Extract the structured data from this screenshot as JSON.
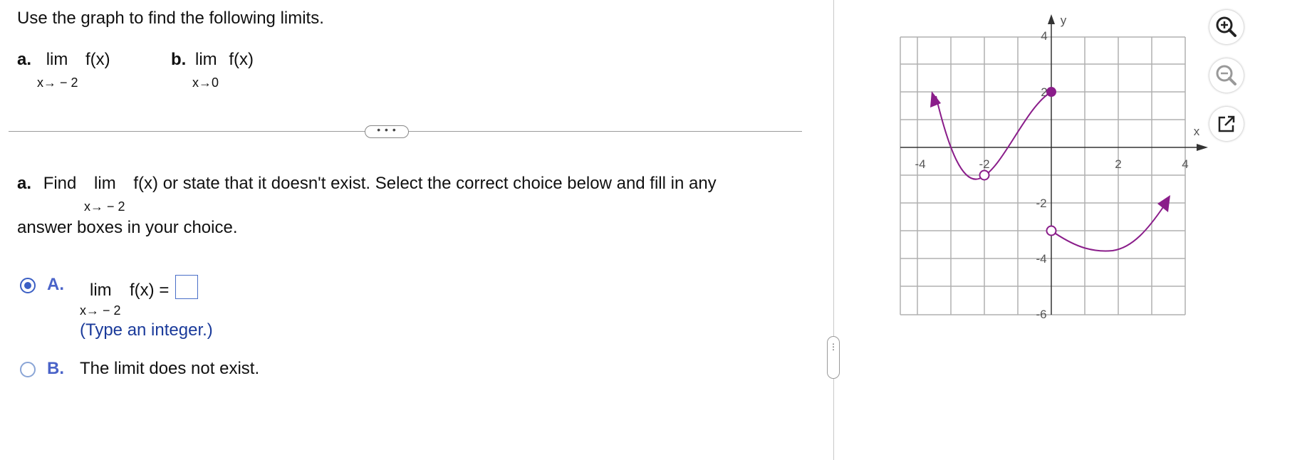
{
  "intro": "Use the graph to find the following limits.",
  "limit_a": {
    "label": "a.",
    "lim": "lim",
    "fn": "f(x)",
    "sub": "x→ − 2"
  },
  "limit_b": {
    "label": "b.",
    "lim": "lim",
    "fn": "f(x)",
    "sub": "x→0"
  },
  "divider_button": "• • •",
  "question": {
    "part": "a.",
    "before": "Find",
    "lim": "lim",
    "after": "f(x) or state that it doesn't exist. Select the correct choice below and fill in any",
    "sub": "x→ − 2",
    "line2": "answer boxes in your choice."
  },
  "choice_a": {
    "letter": "A.",
    "lim": "lim",
    "fn": "f(x) =",
    "sub": "x→ − 2",
    "answer_value": "",
    "hint": "(Type an integer.)",
    "selected": true
  },
  "choice_b": {
    "letter": "B.",
    "text": "The limit does not exist.",
    "selected": false
  },
  "splitter_handle": "•\n•\n•",
  "graph": {
    "x_axis_label": "x",
    "y_axis_label": "y",
    "x_tick_labels": [
      "-4",
      "-2",
      "2",
      "4"
    ],
    "y_tick_labels": [
      "4",
      "2",
      "-2",
      "-4",
      "-6"
    ],
    "curve_color": "#8a1d8a",
    "grid_color": "#b0b0b0"
  },
  "tools": [
    {
      "name": "zoom-in-icon"
    },
    {
      "name": "zoom-out-icon"
    },
    {
      "name": "open-external-icon"
    }
  ]
}
